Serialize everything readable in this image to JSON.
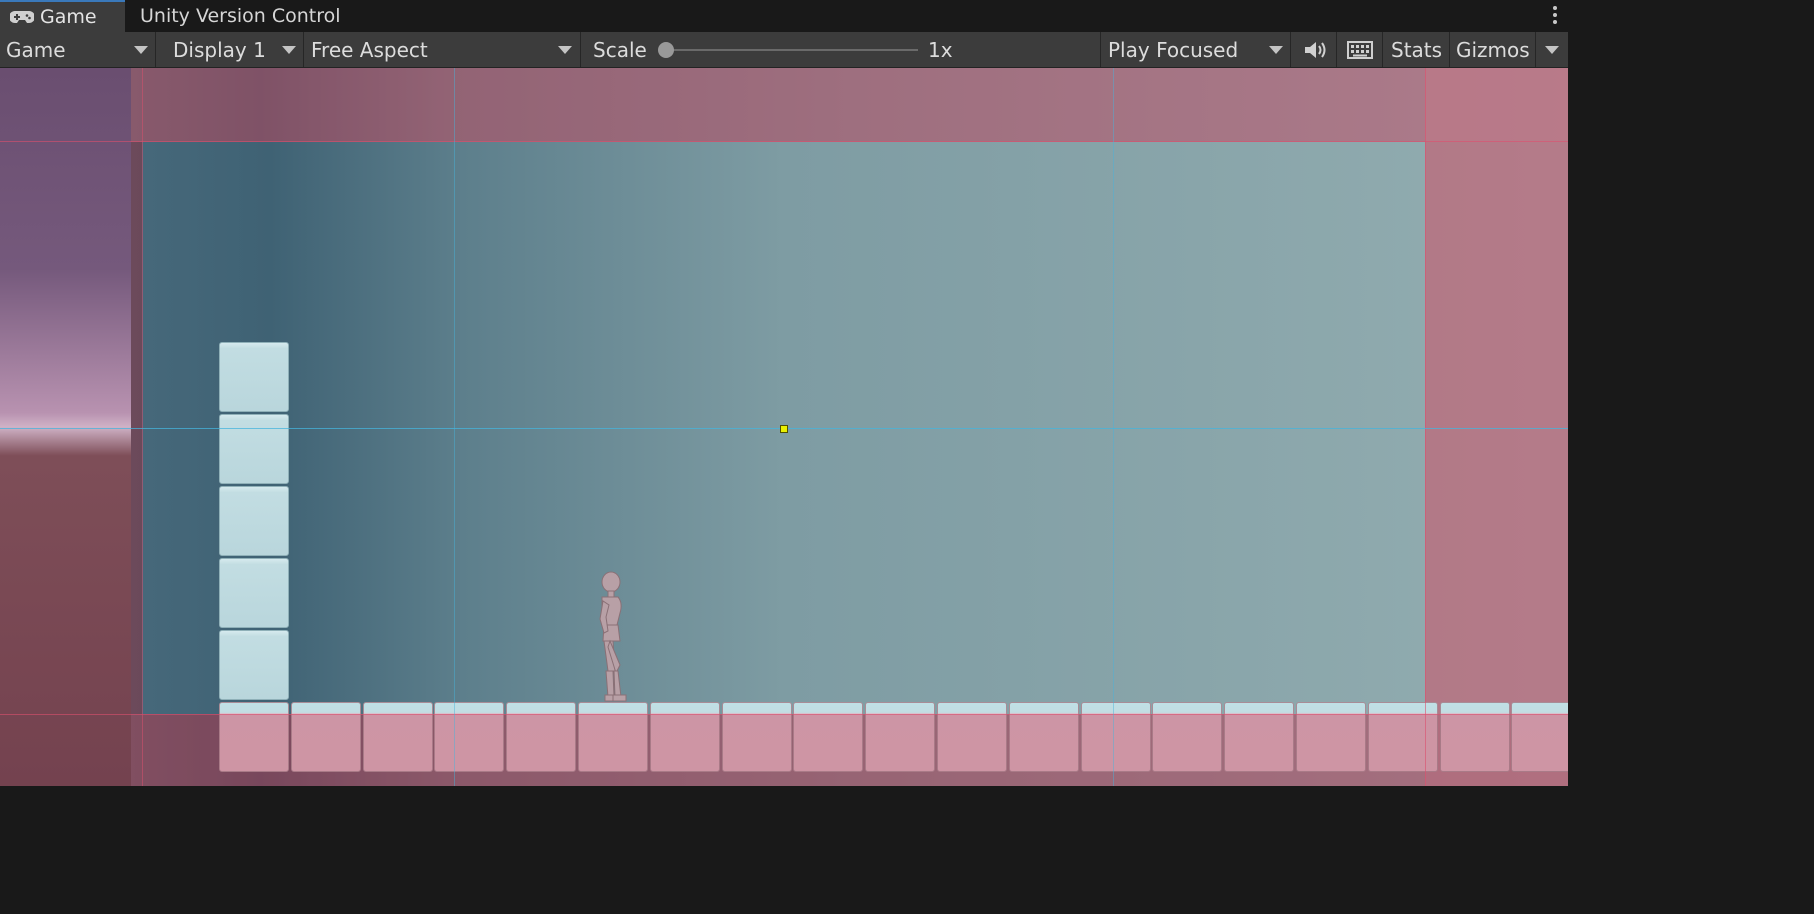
{
  "tabs": {
    "game_label": "Game",
    "version_control_label": "Unity Version Control"
  },
  "toolbar": {
    "view_select": "Game",
    "display_select": "Display 1",
    "aspect_select": "Free Aspect",
    "scale_label": "Scale",
    "scale_value": "1x",
    "scale_fraction": 0,
    "play_mode_select": "Play Focused",
    "stats_label": "Stats",
    "gizmos_label": "Gizmos"
  },
  "icons": {
    "game_tab": "gamepad-icon",
    "audio": "speaker-icon",
    "keyboard": "keyboard-icon",
    "menu": "kebab-menu-icon"
  },
  "colors": {
    "tab_accent": "#3a79bb",
    "camera_guide": "#4fb4d8",
    "deadzone_guide": "#d0506e",
    "target_marker": "#e8f000"
  }
}
